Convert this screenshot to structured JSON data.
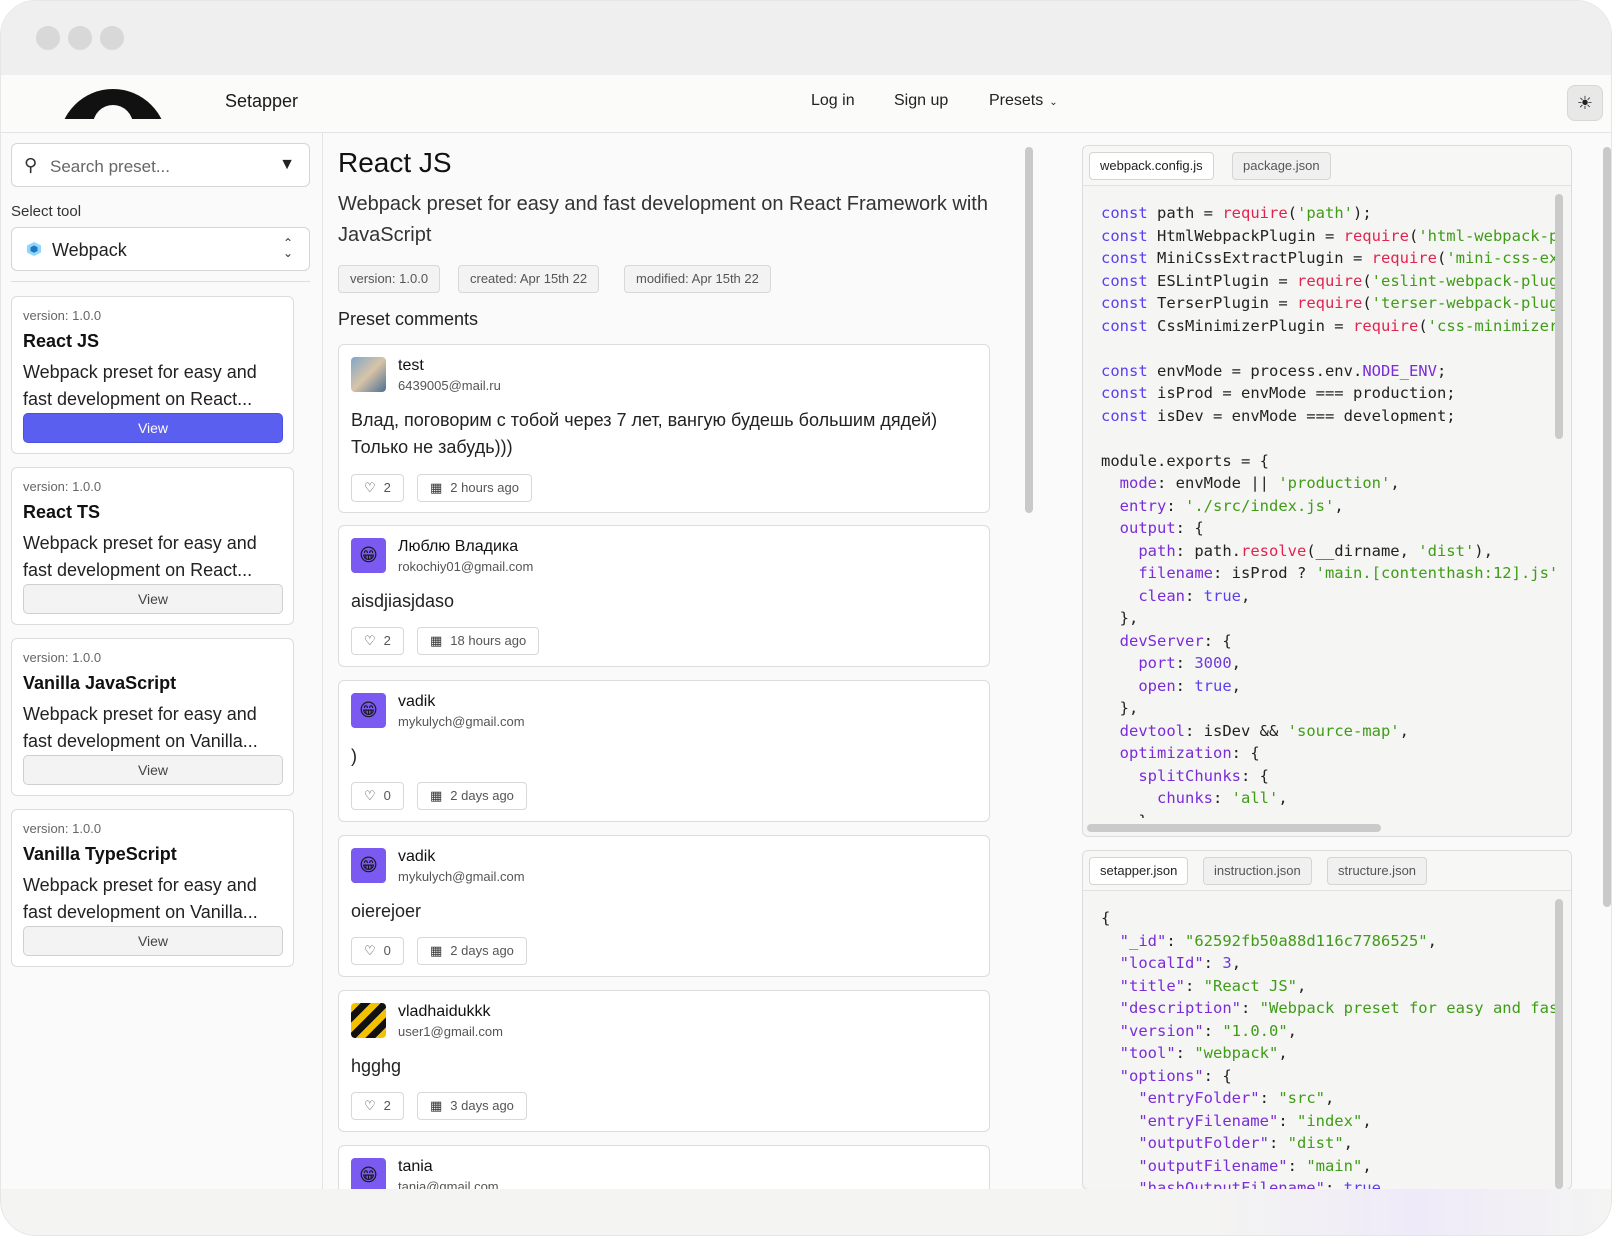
{
  "navbar": {
    "brand": "Setapper",
    "links": [
      "Log in",
      "Sign up",
      "Presets"
    ],
    "theme_icon": "sun-icon"
  },
  "sidebar": {
    "search_placeholder": "Search preset...",
    "select_label": "Select tool",
    "selected_tool": "Webpack",
    "cards": [
      {
        "version": "version: 1.0.0",
        "title": "React JS",
        "desc": "Webpack preset for easy and fast development on React...",
        "button": "View"
      },
      {
        "version": "version: 1.0.0",
        "title": "React TS",
        "desc": "Webpack preset for easy and fast development on React...",
        "button": "View"
      },
      {
        "version": "version: 1.0.0",
        "title": "Vanilla JavaScript",
        "desc": "Webpack preset for easy and fast development on Vanilla...",
        "button": "View"
      },
      {
        "version": "version: 1.0.0",
        "title": "Vanilla TypeScript",
        "desc": "Webpack preset for easy and fast development on Vanilla...",
        "button": "View"
      }
    ]
  },
  "main": {
    "title": "React JS",
    "description": "Webpack preset for easy and fast development on React Framework with JavaScript",
    "tags": [
      "version: 1.0.0",
      "created: Apr 15th 22",
      "modified: Apr 15th 22"
    ],
    "comments_heading": "Preset comments",
    "comments": [
      {
        "name": "test",
        "email": "6439005@mail.ru",
        "text": "Влад, поговорим с тобой через 7 лет, вангую будешь большим дядей) Только не забудь)))",
        "likes": "2",
        "time": "2 hours ago"
      },
      {
        "name": "Люблю Владика",
        "email": "rokochiy01@gmail.com",
        "text": "aisdjiasjdaso",
        "likes": "2",
        "time": "18 hours ago"
      },
      {
        "name": "vadik",
        "email": "mykulych@gmail.com",
        "text": ")",
        "likes": "0",
        "time": "2 days ago"
      },
      {
        "name": "vadik",
        "email": "mykulych@gmail.com",
        "text": "oierejoer",
        "likes": "0",
        "time": "2 days ago"
      },
      {
        "name": "vladhaidukkk",
        "email": "user1@gmail.com",
        "text": "hgghg",
        "likes": "2",
        "time": "3 days ago"
      },
      {
        "name": "tania",
        "email": "tania@gmail.com",
        "text": "",
        "likes": "",
        "time": ""
      }
    ]
  },
  "code_top": {
    "tabs": [
      "webpack.config.js",
      "package.json"
    ],
    "active_tab": "webpack.config.js"
  },
  "code_bottom": {
    "tabs": [
      "setapper.json",
      "instruction.json",
      "structure.json"
    ],
    "active_tab": "setapper.json"
  },
  "colors": {
    "primary_button": "#5b5ff0",
    "code_keyword": "#5b3ff0",
    "code_string": "#3f9c17",
    "code_function": "#e0244f"
  }
}
